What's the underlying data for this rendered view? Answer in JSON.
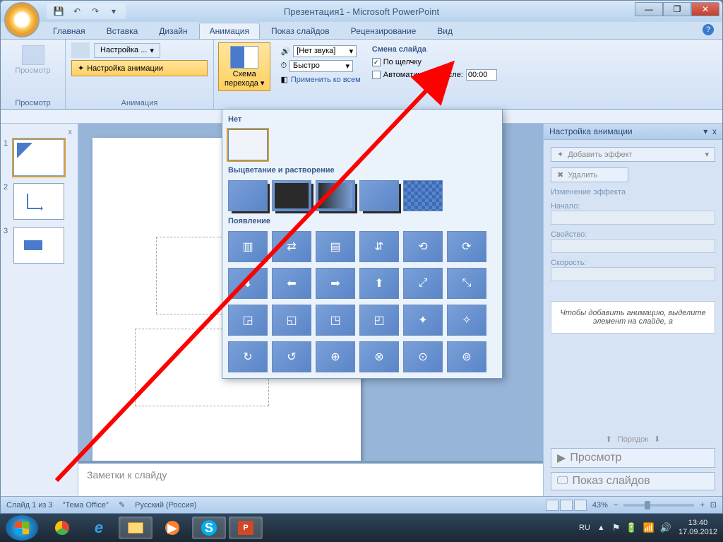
{
  "title": "Презентация1 - Microsoft PowerPoint",
  "tabs": {
    "home": "Главная",
    "insert": "Вставка",
    "design": "Дизайн",
    "animation": "Анимация",
    "slideshow": "Показ слайдов",
    "review": "Рецензирование",
    "view": "Вид"
  },
  "ribbon": {
    "preview_group": "Просмотр",
    "preview_btn": "Просмотр",
    "anim_group": "Анимация",
    "settings_dd": "Настройка ...",
    "settings_anim": "Настройка анимации",
    "scheme_label1": "Схема",
    "scheme_label2": "перехода",
    "sound_label": "[Нет звука]",
    "speed_label": "Быстро",
    "apply_all": "Применить ко всем",
    "advance_title": "Смена слайда",
    "on_click": "По щелчку",
    "auto_after": "Автоматически после:",
    "auto_time": "00:00"
  },
  "gallery": {
    "none": "Нет",
    "fade": "Выцветание и растворение",
    "appear": "Появление"
  },
  "thumbs": [
    "1",
    "2",
    "3"
  ],
  "notes_placeholder": "Заметки к слайду",
  "anim_pane": {
    "title": "Настройка анимации",
    "add_effect": "Добавить эффект",
    "remove": "Удалить",
    "change": "Изменение эффекта",
    "start": "Начало:",
    "property": "Свойство:",
    "speed": "Скорость:",
    "hint": "Чтобы добавить анимацию, выделите элемент на слайде, а",
    "order": "Порядок",
    "preview": "Просмотр",
    "slideshow": "Показ слайдов"
  },
  "status": {
    "slide": "Слайд 1 из 3",
    "theme": "\"Тема Office\"",
    "lang": "Русский (Россия)",
    "zoom": "43%"
  },
  "tray": {
    "lang": "RU",
    "time": "13:40",
    "date": "17.09.2012"
  }
}
